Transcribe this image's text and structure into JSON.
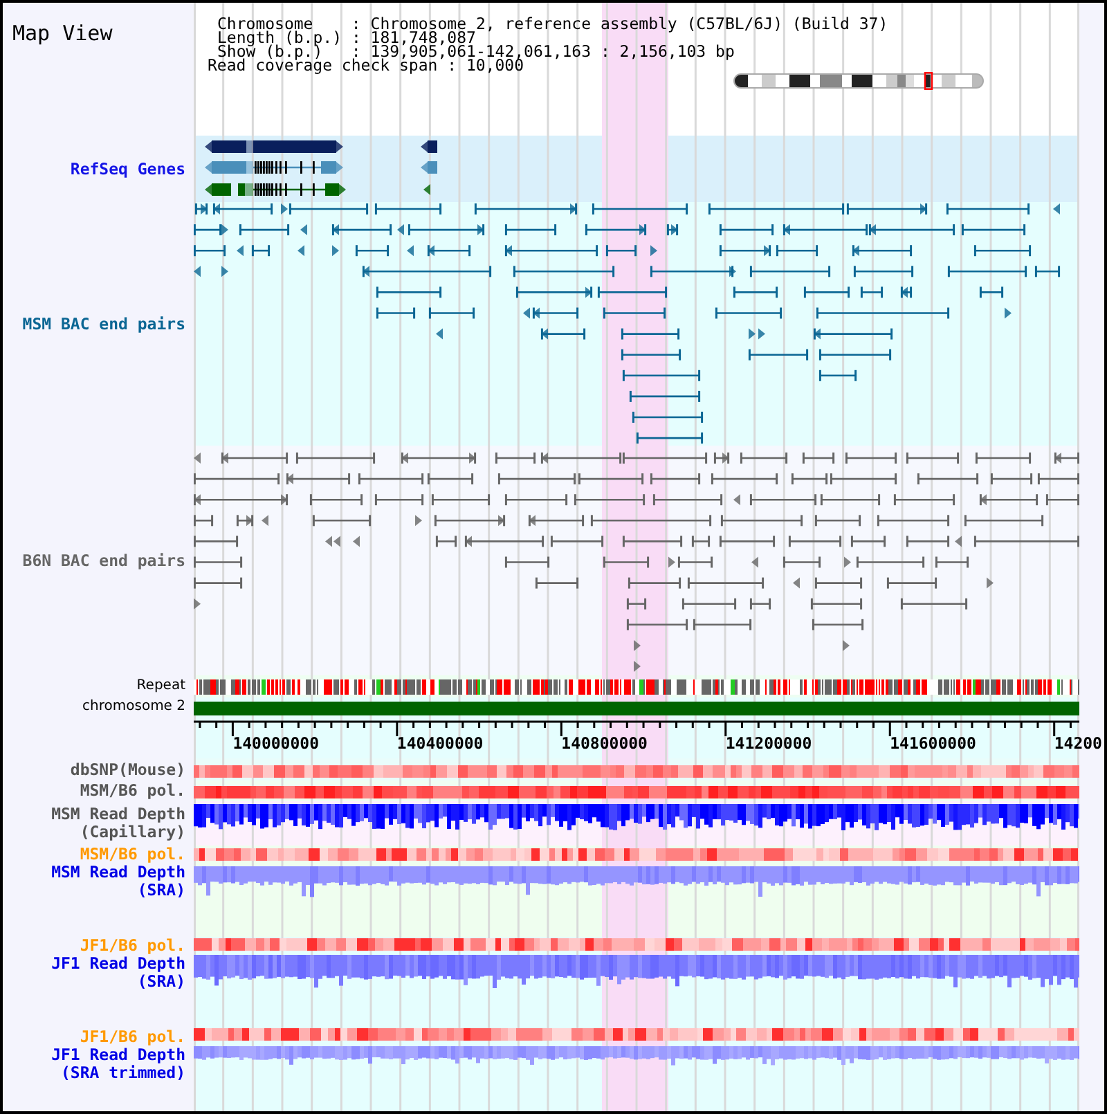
{
  "header": {
    "title": "Map View",
    "info": [
      {
        "kind": "field",
        "label": "Chromosome",
        "sep": ":",
        "value": "Chromosome 2, reference assembly (C57BL/6J) (Build 37)"
      },
      {
        "kind": "field",
        "label": "Length (b.p.)",
        "sep": ":",
        "value": "181,748,087"
      },
      {
        "kind": "field",
        "label": "Show (b.p.)",
        "sep": ":",
        "value": "139,905,061-142,061,163 : 2,156,103 bp"
      },
      {
        "kind": "setting",
        "label": "Read coverage check span",
        "sep": ":",
        "value": "10,000"
      }
    ]
  },
  "tracks": [
    {
      "kind": "genes",
      "label": "RefSeq Genes",
      "color": "#1414e6"
    },
    {
      "kind": "pairs",
      "label": "MSM BAC end pairs",
      "color": "#0b6694"
    },
    {
      "kind": "pairs",
      "label": "B6N BAC end pairs",
      "color": "#666666"
    },
    {
      "kind": "repeat",
      "label": "Repeat"
    },
    {
      "kind": "chromosome",
      "label": "chromosome 2"
    },
    {
      "kind": "ruler",
      "ticks": [
        "140000000",
        "140400000",
        "140800000",
        "141200000",
        "141600000",
        "14200"
      ]
    },
    {
      "kind": "heat",
      "label": "dbSNP(Mouse)",
      "color": "#555555"
    },
    {
      "kind": "heat",
      "label": "MSM/B6 pol.",
      "color": "#555555"
    },
    {
      "kind": "depth",
      "label": "MSM Read Depth",
      "sublabel": "(Capillary)",
      "color": "#555555"
    },
    {
      "kind": "heat",
      "label": "MSM/B6 pol.",
      "color": "#ff9900"
    },
    {
      "kind": "depth",
      "label": "MSM Read Depth",
      "sublabel": "(SRA)",
      "color": "#0000e6"
    },
    {
      "kind": "heat",
      "label": "JF1/B6 pol.",
      "color": "#ff9900"
    },
    {
      "kind": "depth",
      "label": "JF1 Read Depth",
      "sublabel": "(SRA)",
      "color": "#0000e6"
    },
    {
      "kind": "heat",
      "label": "JF1/B6 pol.",
      "color": "#ff9900"
    },
    {
      "kind": "depth",
      "label": "JF1 Read Depth",
      "sublabel": "(SRA trimmed)",
      "color": "#0000e6"
    }
  ]
}
